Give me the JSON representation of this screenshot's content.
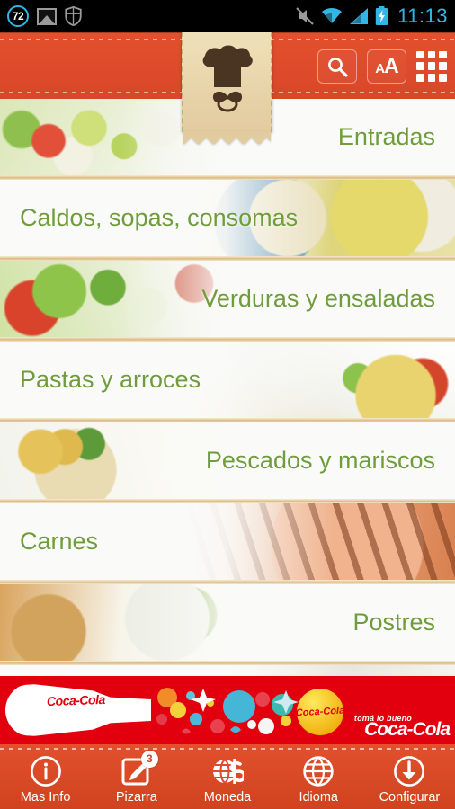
{
  "status_bar": {
    "badge_count": "72",
    "icons_left": [
      "counter-badge-icon",
      "gallery-icon",
      "shield-icon"
    ],
    "icons_right": [
      "mute-icon",
      "wifi-icon",
      "signal-icon",
      "battery-charging-icon"
    ],
    "time": "11:13"
  },
  "header": {
    "logo": "chef-hat-mustache-logo",
    "search_label": "search-icon",
    "textsize_label_small": "A",
    "textsize_label_large": "A",
    "grid_label": "grid-menu-icon",
    "bg_color": "#de4c2b",
    "ribbon_color": "#e7d2a6"
  },
  "menu": {
    "accent_text_color": "#6f9c3c",
    "divider_color": "#ddbd86",
    "categories": [
      {
        "label": "Entradas",
        "image": "art-entradas",
        "align": "right",
        "image_side": "left"
      },
      {
        "label": "Caldos, sopas, consomas",
        "image": "art-caldos",
        "align": "left",
        "image_side": "right"
      },
      {
        "label": "Verduras y ensaladas",
        "image": "art-verduras",
        "align": "right",
        "image_side": "left"
      },
      {
        "label": "Pastas y arroces",
        "image": "art-pastas",
        "align": "left",
        "image_side": "right"
      },
      {
        "label": "Pescados y mariscos",
        "image": "art-pescados",
        "align": "right",
        "image_side": "left"
      },
      {
        "label": "Carnes",
        "image": "art-carnes",
        "align": "left",
        "image_side": "right"
      },
      {
        "label": "Postres",
        "image": "art-postres",
        "align": "right",
        "image_side": "left"
      },
      {
        "label": "",
        "image": "art-partial",
        "align": "left",
        "image_side": "right"
      }
    ]
  },
  "ad": {
    "brand": "Coca-Cola",
    "bottle_text": "Coca-Cola",
    "badge_text": "Coca-Cola",
    "tagline": "tomá lo bueno",
    "wordmark": "Coca-Cola",
    "bg_color": "#e2000f"
  },
  "bottom_nav": {
    "items": [
      {
        "label": "Mas Info",
        "icon": "info-circle-icon",
        "badge": ""
      },
      {
        "label": "Pizarra",
        "icon": "note-pencil-icon",
        "badge": "3"
      },
      {
        "label": "Moneda",
        "icon": "globe-dollar-icon",
        "badge": ""
      },
      {
        "label": "Idioma",
        "icon": "globe-icon",
        "badge": ""
      },
      {
        "label": "Configurar",
        "icon": "download-circle-icon",
        "badge": ""
      }
    ]
  }
}
